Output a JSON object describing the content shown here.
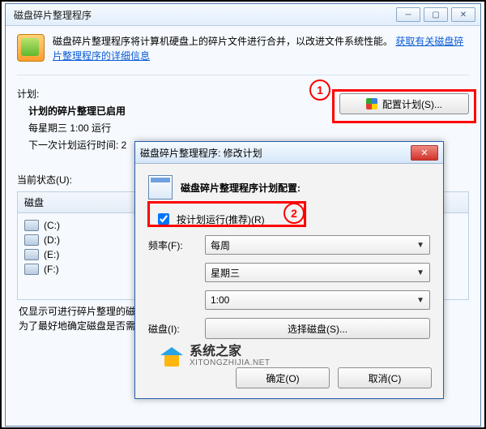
{
  "main": {
    "title": "磁盘碎片整理程序",
    "info_text": "磁盘碎片整理程序将计算机硬盘上的碎片文件进行合并，以改进文件系统性能。",
    "info_link": "获取有关磁盘碎片整理程序的详细信息",
    "schedule_label": "计划:",
    "schedule_enabled": "计划的碎片整理已启用",
    "schedule_time": "每星期三  1:00 运行",
    "next_run_prefix": "下一次计划运行时间: 2",
    "configure_button": "配置计划(S)...",
    "status_label": "当前状态(U):",
    "disk_header": "磁盘",
    "drives": [
      "(C:)",
      "(D:)",
      "(E:)",
      "(F:)"
    ],
    "footer_line1": "仅显示可进行碎片整理的磁",
    "footer_line2": "为了最好地确定磁盘是否需"
  },
  "dialog": {
    "title": "磁盘碎片整理程序: 修改计划",
    "heading": "磁盘碎片整理程序计划配置:",
    "run_on_schedule": "按计划运行(推荐)(R)",
    "freq_label": "频率(F):",
    "freq_value": "每周",
    "day_value": "星期三",
    "time_value": "1:00",
    "disk_label": "磁盘(I):",
    "select_disks": "选择磁盘(S)...",
    "ok": "确定(O)",
    "cancel": "取消(C)"
  },
  "annot": {
    "one": "1",
    "two": "2"
  },
  "watermark": {
    "cn": "系统之家",
    "en": "XITONGZHIJIA.NET"
  }
}
